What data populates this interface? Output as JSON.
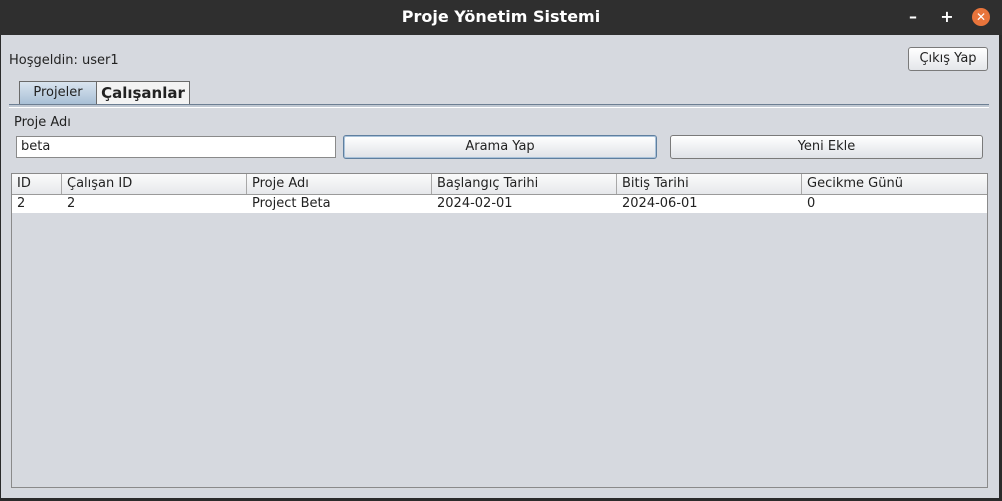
{
  "window": {
    "title": "Proje Yönetim Sistemi",
    "controls": {
      "minimize": "–",
      "maximize": "+",
      "close": "✕"
    }
  },
  "header": {
    "welcome": "Hoşgeldin: user1",
    "logout_label": "Çıkış Yap"
  },
  "tabs": [
    {
      "label": "Projeler",
      "active": true
    },
    {
      "label": "Çalışanlar",
      "active": false
    }
  ],
  "search": {
    "label": "Proje Adı",
    "value": "beta",
    "search_button": "Arama Yap",
    "add_button": "Yeni Ekle"
  },
  "table": {
    "columns": [
      "ID",
      "Çalışan ID",
      "Proje Adı",
      "Başlangıç Tarihi",
      "Bitiş Tarihi",
      "Gecikme Günü"
    ],
    "rows": [
      [
        "2",
        "2",
        "Project Beta",
        "2024-02-01",
        "2024-06-01",
        "0"
      ]
    ]
  },
  "colors": {
    "titlebar": "#2f2f2f",
    "client_bg": "#d6d9df",
    "close_button": "#e8743b",
    "tab_active": "#a9c0d6"
  }
}
